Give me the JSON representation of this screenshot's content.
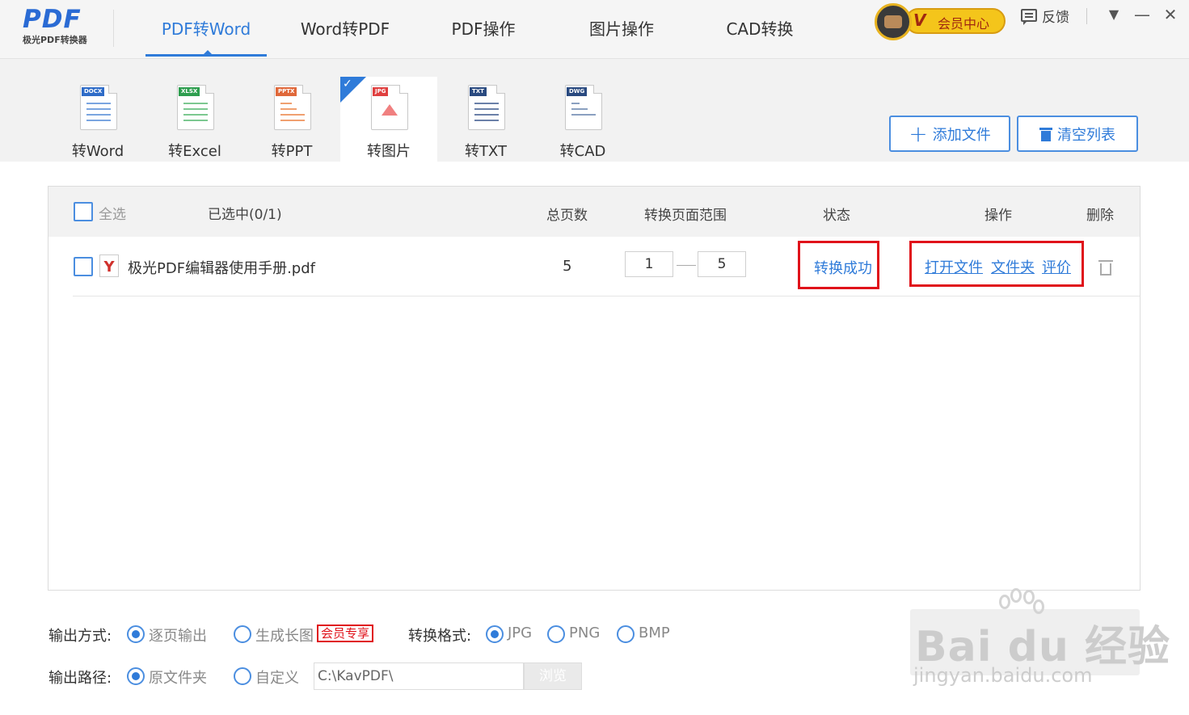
{
  "app": {
    "logo_mark": "PDF",
    "logo_sub": "极光PDF转换器"
  },
  "nav": {
    "tabs": [
      {
        "label": "PDF转Word",
        "active": true
      },
      {
        "label": "Word转PDF",
        "active": false
      },
      {
        "label": "PDF操作",
        "active": false
      },
      {
        "label": "图片操作",
        "active": false
      },
      {
        "label": "CAD转换",
        "active": false
      }
    ]
  },
  "header": {
    "vip_letter": "V",
    "vip_label": "会员中心",
    "feedback_label": "反馈",
    "menu_glyph": "▼",
    "minimize_glyph": "—",
    "close_glyph": "✕"
  },
  "convert_types": [
    {
      "label": "转Word",
      "tag": "DOCX",
      "tag_color": "#2f6cc8",
      "active": false
    },
    {
      "label": "转Excel",
      "tag": "XLSX",
      "tag_color": "#2e9e4f",
      "active": false
    },
    {
      "label": "转PPT",
      "tag": "PPTX",
      "tag_color": "#e0683a",
      "active": false
    },
    {
      "label": "转图片",
      "tag": "JPG",
      "tag_color": "#e04040",
      "active": true
    },
    {
      "label": "转TXT",
      "tag": "TXT",
      "tag_color": "#2a4a80",
      "active": false
    },
    {
      "label": "转CAD",
      "tag": "DWG",
      "tag_color": "#2a4a80",
      "active": false
    }
  ],
  "actions": {
    "add_file": "添加文件",
    "clear_list": "清空列表"
  },
  "table": {
    "headers": {
      "select_all": "全选",
      "selected_count": "已选中(0/1)",
      "total_pages": "总页数",
      "page_range": "转换页面范围",
      "status": "状态",
      "operations": "操作",
      "delete": "删除"
    },
    "rows": [
      {
        "filename": "极光PDF编辑器使用手册.pdf",
        "total_pages": "5",
        "range_from": "1",
        "range_to": "5",
        "status": "转换成功",
        "op_open": "打开文件",
        "op_folder": "文件夹",
        "op_rate": "评价"
      }
    ]
  },
  "options": {
    "output_mode_label": "输出方式:",
    "mode_per_page": "逐页输出",
    "mode_long_image": "生成长图",
    "vip_only": "会员专享",
    "format_label": "转换格式:",
    "formats": [
      "JPG",
      "PNG",
      "BMP"
    ],
    "selected_format": "JPG",
    "output_path_label": "输出路径:",
    "path_original": "原文件夹",
    "path_custom": "自定义",
    "path_value": "C:\\KavPDF\\",
    "browse": "浏览"
  },
  "watermark": {
    "text": "Bai du 经验",
    "url": "jingyan.baidu.com"
  },
  "colors": {
    "accent": "#2f7bd9",
    "highlight_red": "#e0121a",
    "vip_gold": "#f4c51b"
  }
}
